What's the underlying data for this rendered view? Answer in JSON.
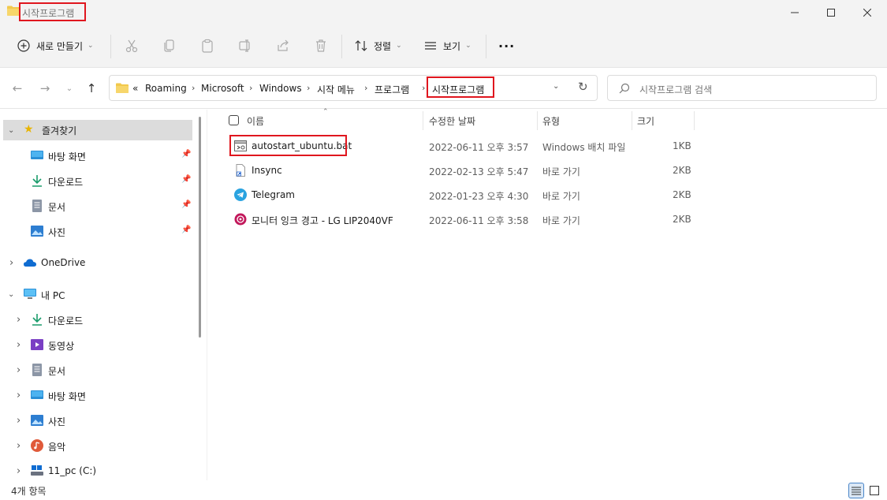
{
  "window": {
    "title": "시작프로그램"
  },
  "toolbar": {
    "new_label": "새로 만들기",
    "sort_label": "정렬",
    "view_label": "보기",
    "more_label": "···"
  },
  "address": {
    "overflow": "«",
    "crumbs": [
      "Roaming",
      "Microsoft",
      "Windows",
      "시작 메뉴",
      "프로그램",
      "시작프로그램"
    ],
    "search_placeholder": "시작프로그램 검색"
  },
  "sidebar": {
    "quick_access": "즐겨찾기",
    "pinned": [
      {
        "label": "바탕 화면",
        "icon": "desktop-icon"
      },
      {
        "label": "다운로드",
        "icon": "download-icon"
      },
      {
        "label": "문서",
        "icon": "document-icon"
      },
      {
        "label": "사진",
        "icon": "pictures-icon"
      }
    ],
    "onedrive": "OneDrive",
    "this_pc": "내 PC",
    "pc_items": [
      {
        "label": "다운로드",
        "icon": "download-icon"
      },
      {
        "label": "동영상",
        "icon": "videos-icon"
      },
      {
        "label": "문서",
        "icon": "document-icon"
      },
      {
        "label": "바탕 화면",
        "icon": "desktop-icon"
      },
      {
        "label": "사진",
        "icon": "pictures-icon"
      },
      {
        "label": "음악",
        "icon": "music-icon"
      },
      {
        "label": "11_pc (C:)",
        "icon": "drive-icon"
      }
    ]
  },
  "list": {
    "columns": {
      "name": "이름",
      "date": "수정한 날짜",
      "type": "유형",
      "size": "크기"
    },
    "rows": [
      {
        "name": "autostart_ubuntu.bat",
        "date": "2022-06-11 오후 3:57",
        "type": "Windows 배치 파일",
        "size": "1KB",
        "icon": "batch-file-icon"
      },
      {
        "name": "Insync",
        "date": "2022-02-13 오후 5:47",
        "type": "바로 가기",
        "size": "2KB",
        "icon": "shortcut-icon"
      },
      {
        "name": "Telegram",
        "date": "2022-01-23 오후 4:30",
        "type": "바로 가기",
        "size": "2KB",
        "icon": "telegram-icon"
      },
      {
        "name": "모니터 잉크 경고 - LG LIP2040VF",
        "date": "2022-06-11 오후 3:58",
        "type": "바로 가기",
        "size": "2KB",
        "icon": "printer-shortcut-icon"
      }
    ]
  },
  "status": {
    "count": "4개 항목"
  },
  "colors": {
    "highlight": "#e0161e",
    "folder": "#f2c94c",
    "selected": "#dcdcdc"
  }
}
